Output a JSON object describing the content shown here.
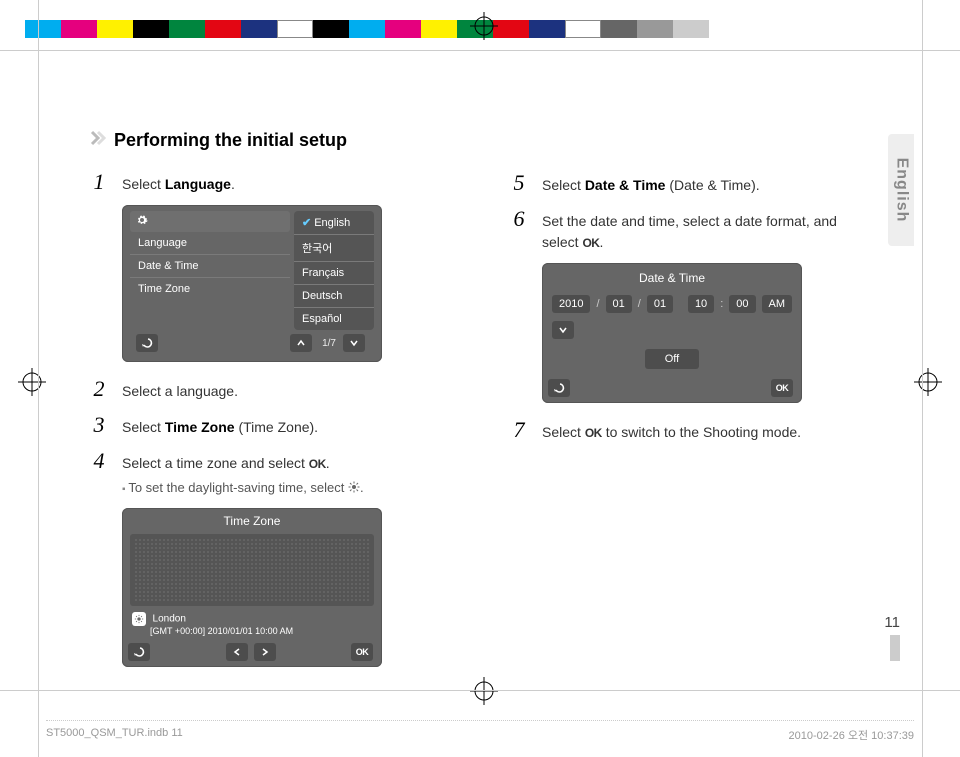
{
  "colorbar": [
    "#00adef",
    "#e5007e",
    "#fff100",
    "#000000",
    "#00853e",
    "#e30613",
    "#1c327f",
    "#ffffff",
    "#000000",
    "#00adef",
    "#e5007e",
    "#fff100",
    "#00853e",
    "#e30613",
    "#1c327f",
    "#ffffff",
    "#666666",
    "#999999",
    "#cccccc"
  ],
  "lang_tab": "English",
  "heading": "Performing the initial setup",
  "left_steps": {
    "s1": "Select <b>Language</b>.",
    "s2": "Select a language.",
    "s3": "Select <b>Time Zone</b> (Time Zone).",
    "s4": "Select a time zone and select <span class='ok'>OK</span>.",
    "s4_sub": "To set the daylight-saving time, select "
  },
  "right_steps": {
    "s5": "Select <b>Date & Time</b> (Date & Time).",
    "s6": "Set the date and time, select a date format, and select <span class='ok'>OK</span>.",
    "s7": "Select <span class='ok'>OK</span> to switch to the Shooting mode."
  },
  "lang_panel": {
    "left_items": [
      "Language",
      "Date & Time",
      "Time Zone"
    ],
    "right_items": [
      "English",
      "한국어",
      "Français",
      "Deutsch",
      "Español"
    ],
    "pager": "1/7"
  },
  "tz_panel": {
    "title": "Time Zone",
    "city": "London",
    "info": "[GMT +00:00] 2010/01/01 10:00 AM"
  },
  "dt_panel": {
    "title": "Date & Time",
    "year": "2010",
    "mon": "01",
    "day": "01",
    "hour": "10",
    "min": "00",
    "ampm": "AM",
    "off": "Off"
  },
  "page_number": "11",
  "doc_footer_left": "ST5000_QSM_TUR.indb   11",
  "doc_footer_right": "2010-02-26   오전 10:37:39"
}
